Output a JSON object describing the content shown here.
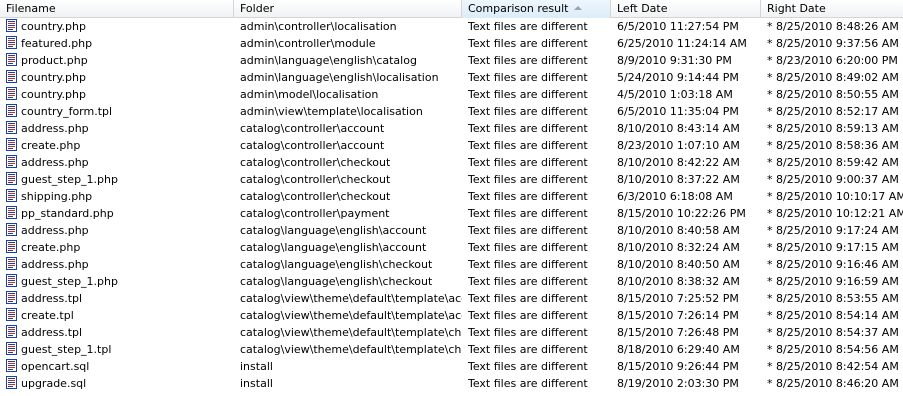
{
  "columns": {
    "filename": "Filename",
    "folder": "Folder",
    "comparison": "Comparison result",
    "left_date": "Left Date",
    "right_date": "Right Date"
  },
  "sort": {
    "column": "comparison",
    "direction": "ascending"
  },
  "icons": {
    "file": "file-icon",
    "sort": "sort-ascending-icon"
  },
  "colors": {
    "icon_border": "#1e3fa0",
    "icon_fill": "#ffffff",
    "icon_accent": "#c0302a"
  },
  "rows": [
    {
      "filename": "country.php",
      "folder": "admin\\controller\\localisation",
      "result": "Text files are different",
      "left": "6/5/2010 11:27:54 PM",
      "right": "* 8/25/2010 8:48:26 AM"
    },
    {
      "filename": "featured.php",
      "folder": "admin\\controller\\module",
      "result": "Text files are different",
      "left": "6/25/2010 11:24:14 AM",
      "right": "* 8/25/2010 9:37:56 AM"
    },
    {
      "filename": "product.php",
      "folder": "admin\\language\\english\\catalog",
      "result": "Text files are different",
      "left": "8/9/2010 9:31:30 PM",
      "right": "* 8/23/2010 6:20:00 PM"
    },
    {
      "filename": "country.php",
      "folder": "admin\\language\\english\\localisation",
      "result": "Text files are different",
      "left": "5/24/2010 9:14:44 PM",
      "right": "* 8/25/2010 8:49:02 AM"
    },
    {
      "filename": "country.php",
      "folder": "admin\\model\\localisation",
      "result": "Text files are different",
      "left": "4/5/2010 1:03:18 AM",
      "right": "* 8/25/2010 8:50:55 AM"
    },
    {
      "filename": "country_form.tpl",
      "folder": "admin\\view\\template\\localisation",
      "result": "Text files are different",
      "left": "6/5/2010 11:35:04 PM",
      "right": "* 8/25/2010 8:52:17 AM"
    },
    {
      "filename": "address.php",
      "folder": "catalog\\controller\\account",
      "result": "Text files are different",
      "left": "8/10/2010 8:43:14 AM",
      "right": "* 8/25/2010 8:59:13 AM"
    },
    {
      "filename": "create.php",
      "folder": "catalog\\controller\\account",
      "result": "Text files are different",
      "left": "8/23/2010 1:07:10 AM",
      "right": "* 8/25/2010 8:58:36 AM"
    },
    {
      "filename": "address.php",
      "folder": "catalog\\controller\\checkout",
      "result": "Text files are different",
      "left": "8/10/2010 8:42:22 AM",
      "right": "* 8/25/2010 8:59:42 AM"
    },
    {
      "filename": "guest_step_1.php",
      "folder": "catalog\\controller\\checkout",
      "result": "Text files are different",
      "left": "8/10/2010 8:37:22 AM",
      "right": "* 8/25/2010 9:00:37 AM"
    },
    {
      "filename": "shipping.php",
      "folder": "catalog\\controller\\checkout",
      "result": "Text files are different",
      "left": "6/3/2010 6:18:08 AM",
      "right": "* 8/25/2010 10:10:17 AM"
    },
    {
      "filename": "pp_standard.php",
      "folder": "catalog\\controller\\payment",
      "result": "Text files are different",
      "left": "8/15/2010 10:22:26 PM",
      "right": "* 8/25/2010 10:12:21 AM"
    },
    {
      "filename": "address.php",
      "folder": "catalog\\language\\english\\account",
      "result": "Text files are different",
      "left": "8/10/2010 8:40:58 AM",
      "right": "* 8/25/2010 9:17:24 AM"
    },
    {
      "filename": "create.php",
      "folder": "catalog\\language\\english\\account",
      "result": "Text files are different",
      "left": "8/10/2010 8:32:24 AM",
      "right": "* 8/25/2010 9:17:15 AM"
    },
    {
      "filename": "address.php",
      "folder": "catalog\\language\\english\\checkout",
      "result": "Text files are different",
      "left": "8/10/2010 8:40:50 AM",
      "right": "* 8/25/2010 9:16:46 AM"
    },
    {
      "filename": "guest_step_1.php",
      "folder": "catalog\\language\\english\\checkout",
      "result": "Text files are different",
      "left": "8/10/2010 8:38:32 AM",
      "right": "* 8/25/2010 9:16:59 AM"
    },
    {
      "filename": "address.tpl",
      "folder": "catalog\\view\\theme\\default\\template\\acc...",
      "result": "Text files are different",
      "left": "8/15/2010 7:25:52 PM",
      "right": "* 8/25/2010 8:53:55 AM"
    },
    {
      "filename": "create.tpl",
      "folder": "catalog\\view\\theme\\default\\template\\acc...",
      "result": "Text files are different",
      "left": "8/15/2010 7:26:14 PM",
      "right": "* 8/25/2010 8:54:14 AM"
    },
    {
      "filename": "address.tpl",
      "folder": "catalog\\view\\theme\\default\\template\\che...",
      "result": "Text files are different",
      "left": "8/15/2010 7:26:48 PM",
      "right": "* 8/25/2010 8:54:37 AM"
    },
    {
      "filename": "guest_step_1.tpl",
      "folder": "catalog\\view\\theme\\default\\template\\che...",
      "result": "Text files are different",
      "left": "8/18/2010 6:29:40 AM",
      "right": "* 8/25/2010 8:54:56 AM"
    },
    {
      "filename": "opencart.sql",
      "folder": "install",
      "result": "Text files are different",
      "left": "8/15/2010 9:26:44 PM",
      "right": "* 8/25/2010 8:42:54 AM"
    },
    {
      "filename": "upgrade.sql",
      "folder": "install",
      "result": "Text files are different",
      "left": "8/19/2010 2:03:30 PM",
      "right": "* 8/25/2010 8:46:20 AM"
    }
  ]
}
